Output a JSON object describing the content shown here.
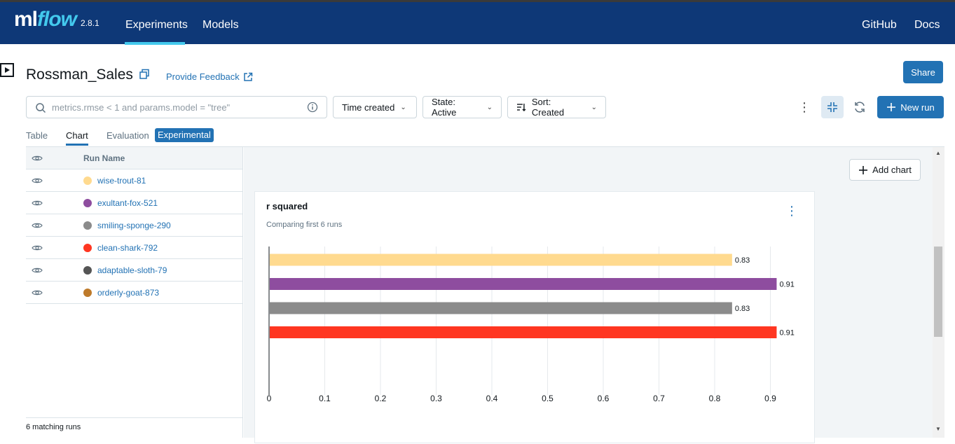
{
  "header": {
    "logo_ml": "ml",
    "logo_flow": "flow",
    "version": "2.8.1",
    "nav": {
      "experiments": "Experiments",
      "models": "Models",
      "github": "GitHub",
      "docs": "Docs"
    }
  },
  "page": {
    "title": "Rossman_Sales",
    "feedback": "Provide Feedback",
    "share": "Share"
  },
  "toolbar": {
    "search_placeholder": "metrics.rmse < 1 and params.model = \"tree\"",
    "time_created": "Time created",
    "state": "State: Active",
    "sort": "Sort: Created",
    "new_run": "New run"
  },
  "tabs": {
    "table": "Table",
    "chart": "Chart",
    "evaluation": "Evaluation",
    "experimental": "Experimental"
  },
  "runs": {
    "header": "Run Name",
    "items": [
      {
        "name": "wise-trout-81",
        "color": "#ffda8f"
      },
      {
        "name": "exultant-fox-521",
        "color": "#8e4d9f"
      },
      {
        "name": "smiling-sponge-290",
        "color": "#8b8b8b"
      },
      {
        "name": "clean-shark-792",
        "color": "#ff3621"
      },
      {
        "name": "adaptable-sloth-79",
        "color": "#555555"
      },
      {
        "name": "orderly-goat-873",
        "color": "#be7a2a"
      }
    ],
    "footer": "6 matching runs"
  },
  "charts": {
    "add_chart": "Add chart",
    "card_title": "r squared",
    "card_subtitle": "Comparing first 6 runs"
  },
  "chart_data": {
    "type": "bar",
    "orientation": "horizontal",
    "title": "r squared",
    "subtitle": "Comparing first 6 runs",
    "categories": [
      "wise-trout-81",
      "exultant-fox-521",
      "smiling-sponge-290",
      "clean-shark-792"
    ],
    "values": [
      0.83,
      0.91,
      0.83,
      0.91
    ],
    "value_labels": [
      "0.83",
      "0.91",
      "0.83",
      "0.91"
    ],
    "colors": [
      "#ffda8f",
      "#8e4d9f",
      "#8b8b8b",
      "#ff3621"
    ],
    "xticks": [
      "0",
      "0.1",
      "0.2",
      "0.3",
      "0.4",
      "0.5",
      "0.6",
      "0.7",
      "0.8",
      "0.9"
    ],
    "xlim": [
      0,
      0.9
    ],
    "grid": true
  }
}
